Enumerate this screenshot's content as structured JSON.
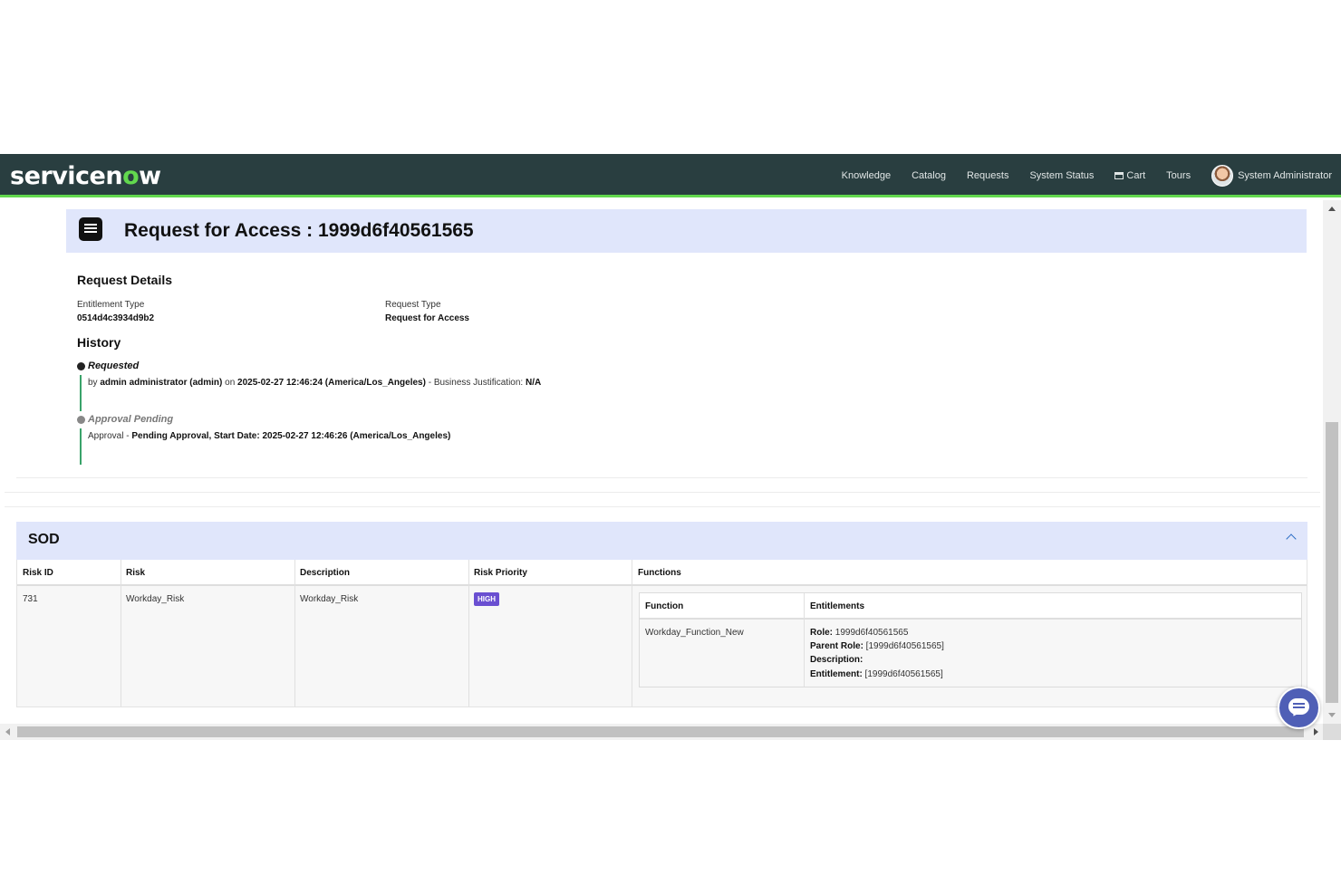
{
  "navbar": {
    "logo": {
      "left": "servicen",
      "o": "o",
      "right": "w"
    },
    "links": [
      "Knowledge",
      "Catalog",
      "Requests",
      "System Status",
      "Cart",
      "Tours"
    ],
    "user_name": "System Administrator"
  },
  "request": {
    "title": "Request for Access : 1999d6f40561565",
    "details_heading": "Request Details",
    "entitlement_type_label": "Entitlement Type",
    "entitlement_type_value": "0514d4c3934d9b2",
    "request_type_label": "Request Type",
    "request_type_value": "Request for Access"
  },
  "history": {
    "heading": "History",
    "items": [
      {
        "status": "Requested",
        "prefix": "by ",
        "actor": "admin administrator (admin)",
        "on": " on ",
        "timestamp": "2025-02-27 12:46:24 (America/Los_Angeles)",
        "suffix": " - Business Justification: ",
        "justification": "N/A",
        "dot_color": "#222222"
      },
      {
        "status": "Approval Pending",
        "prefix": "Approval - ",
        "detail": "Pending Approval, Start Date: 2025-02-27 12:46:26 (America/Los_Angeles)",
        "dot_color": "#888888"
      }
    ]
  },
  "sod": {
    "title": "SOD",
    "columns": [
      "Risk ID",
      "Risk",
      "Description",
      "Risk Priority",
      "Functions"
    ],
    "rows": [
      {
        "risk_id": "731",
        "risk": "Workday_Risk",
        "description": "Workday_Risk",
        "priority": "HIGH",
        "functions": {
          "columns": [
            "Function",
            "Entitlements"
          ],
          "rows": [
            {
              "function": "Workday_Function_New",
              "entitlements": [
                {
                  "label": "Role:",
                  "value": " 1999d6f40561565"
                },
                {
                  "label": "Parent Role:",
                  "value": " [1999d6f40561565]"
                },
                {
                  "label": "Description:",
                  "value": ""
                },
                {
                  "label": "Entitlement:",
                  "value": " [1999d6f40561565]"
                }
              ]
            }
          ]
        }
      }
    ]
  },
  "colors": {
    "navbar_bg": "#293e40",
    "accent_green": "#62d84e",
    "header_band": "#e0e6fb",
    "priority_high": "#6a4fd1",
    "chat_button": "#4f5fb6"
  }
}
